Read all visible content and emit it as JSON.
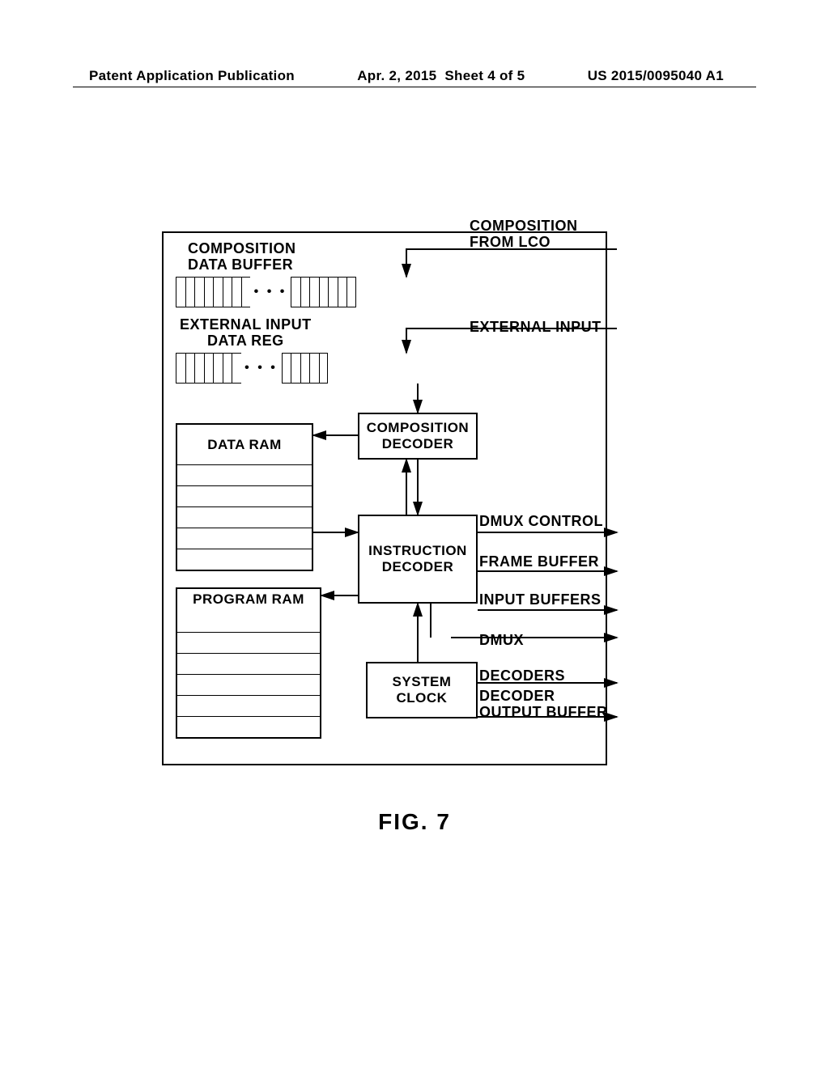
{
  "header": {
    "left": "Patent Application Publication",
    "center": "Apr. 2, 2015  Sheet 4 of 5",
    "right": "US 2015/0095040 A1"
  },
  "labels": {
    "comp_buf": "COMPOSITION\nDATA BUFFER",
    "ext_reg": "EXTERNAL INPUT\nDATA REG",
    "comp_from_lco": "COMPOSITION\nFROM LCO",
    "ext_input": "EXTERNAL INPUT",
    "comp_decoder": "COMPOSITION\nDECODER",
    "data_ram": "DATA RAM",
    "program_ram": "PROGRAM\nRAM",
    "instr_decoder": "INSTRUCTION\nDECODER",
    "system_clock": "SYSTEM\nCLOCK",
    "out_dmux_ctrl": "DMUX CONTROL",
    "out_frame_buf": "FRAME BUFFER",
    "out_input_buf": "INPUT BUFFERS",
    "out_dmux": "DMUX",
    "out_decoders": "DECODERS",
    "out_dec_out_buf": "DECODER\nOUTPUT BUFFER"
  },
  "figure": "FIG. 7",
  "chart_data": {
    "type": "block-diagram",
    "title": "FIG. 7",
    "blocks": [
      {
        "id": "comp_buf",
        "label": "COMPOSITION DATA BUFFER",
        "kind": "register-array"
      },
      {
        "id": "ext_reg",
        "label": "EXTERNAL INPUT DATA REG",
        "kind": "register-array"
      },
      {
        "id": "data_ram",
        "label": "DATA RAM",
        "kind": "ram"
      },
      {
        "id": "program_ram",
        "label": "PROGRAM RAM",
        "kind": "ram"
      },
      {
        "id": "comp_decoder",
        "label": "COMPOSITION DECODER",
        "kind": "block"
      },
      {
        "id": "instr_decoder",
        "label": "INSTRUCTION DECODER",
        "kind": "block"
      },
      {
        "id": "system_clock",
        "label": "SYSTEM CLOCK",
        "kind": "block"
      }
    ],
    "external_inputs": [
      {
        "label": "COMPOSITION FROM LCO",
        "to": "comp_buf"
      },
      {
        "label": "EXTERNAL INPUT",
        "to": "ext_reg"
      }
    ],
    "external_outputs": [
      {
        "from": "instr_decoder",
        "label": "DMUX CONTROL"
      },
      {
        "from": "instr_decoder",
        "label": "FRAME BUFFER"
      },
      {
        "from": "instr_decoder",
        "label": "INPUT BUFFERS"
      },
      {
        "from": "instr_decoder",
        "label": "DMUX"
      },
      {
        "from": "system_clock",
        "label": "DECODERS"
      },
      {
        "from": "system_clock",
        "label": "DECODER OUTPUT BUFFER"
      }
    ],
    "edges": [
      {
        "from": "comp_buf",
        "to": "comp_decoder"
      },
      {
        "from": "ext_reg",
        "to": "comp_decoder"
      },
      {
        "from": "comp_decoder",
        "to": "data_ram",
        "bidir": true
      },
      {
        "from": "comp_decoder",
        "to": "instr_decoder",
        "bidir": true
      },
      {
        "from": "data_ram",
        "to": "instr_decoder"
      },
      {
        "from": "instr_decoder",
        "to": "program_ram",
        "bidir": true
      },
      {
        "from": "system_clock",
        "to": "instr_decoder"
      }
    ]
  }
}
